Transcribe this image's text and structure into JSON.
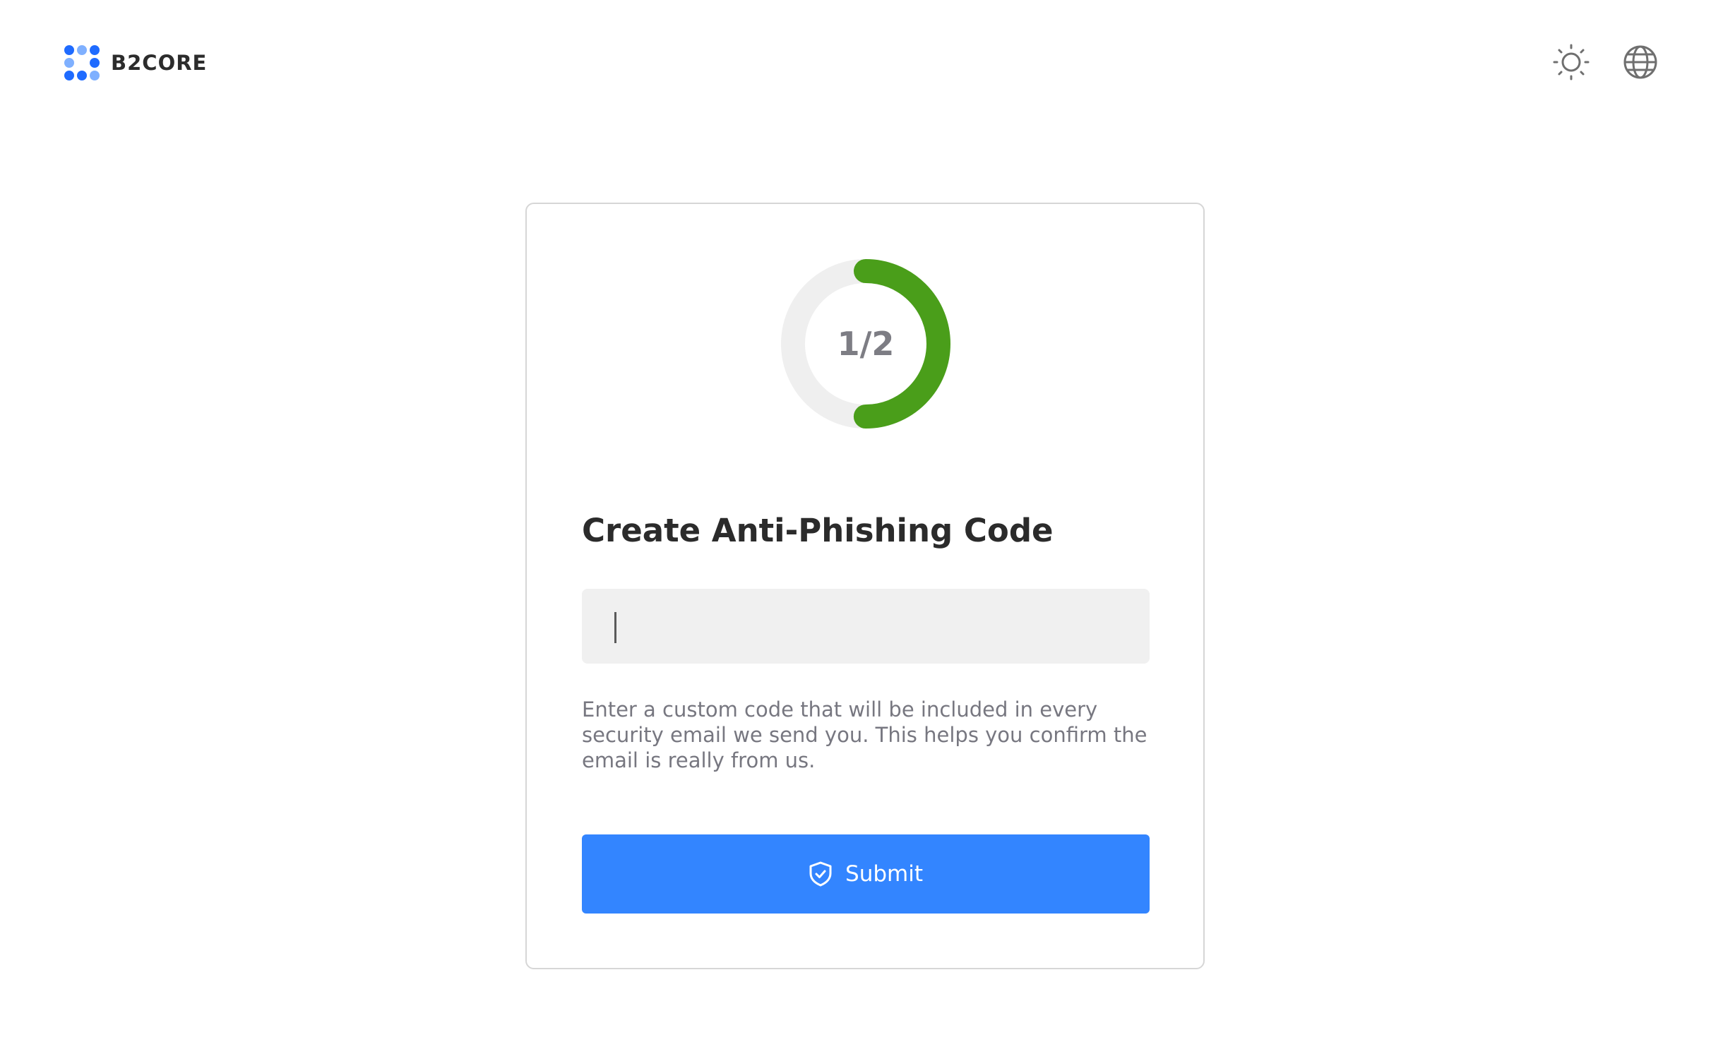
{
  "header": {
    "brand_name": "B2CORE",
    "logo_icon": "b2core-logo-icon",
    "theme_toggle_icon": "sun-icon",
    "language_icon": "globe-icon"
  },
  "step_progress": {
    "label": "1/2",
    "current": 1,
    "total": 2,
    "progress_fraction": 0.5,
    "color": "#4a9e1a",
    "track_color": "#efefef"
  },
  "form": {
    "title": "Create Anti-Phishing Code",
    "code_value": "",
    "code_placeholder": "",
    "hint": "Enter a custom code that will be included in every security email we send you. This helps you confirm the email is really from us.",
    "submit_label": "Submit",
    "submit_icon": "shield-check-icon",
    "accent_color": "#3385ff"
  }
}
